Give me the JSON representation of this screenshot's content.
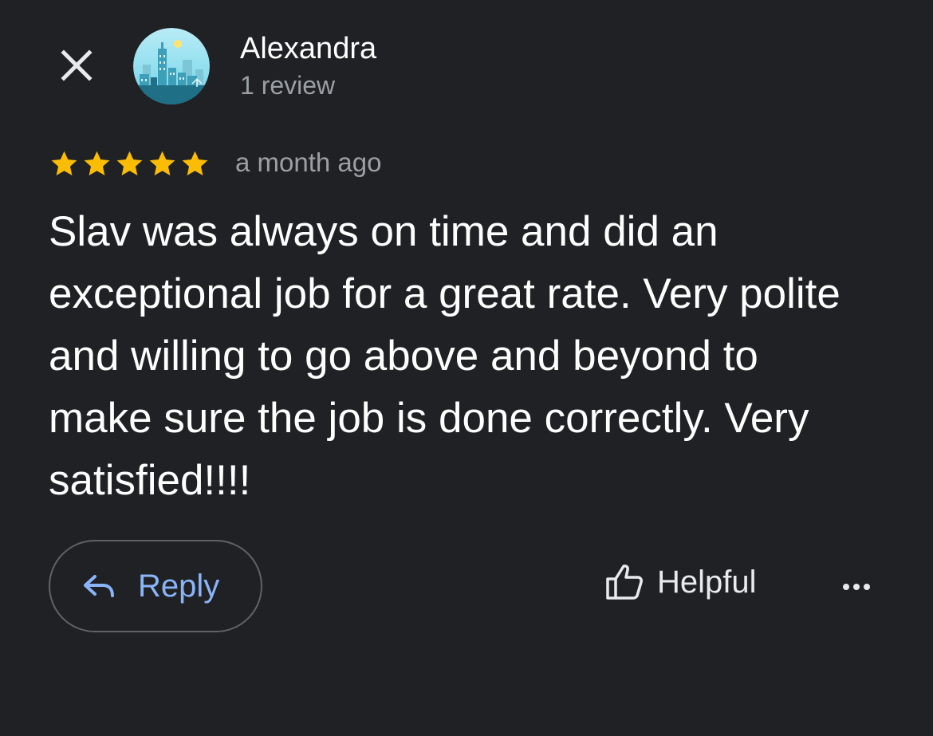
{
  "colors": {
    "background": "#202124",
    "primary_text": "#ffffff",
    "secondary_text": "#9aa0a6",
    "accent": "#8ab4f8",
    "star": "#fbbc04",
    "button_border": "#5f6368"
  },
  "header": {
    "close_icon": "close-icon",
    "avatar_icon": "city-skyline-avatar",
    "author_name": "Alexandra",
    "author_meta": "1 review"
  },
  "review": {
    "rating": 5,
    "rating_max": 5,
    "time_ago": "a month ago",
    "text": "Slav was always on time and did an exceptional job for a great rate. Very polite and willing to go above and beyond to make sure the job is done correctly. Very satisfied!!!!"
  },
  "actions": {
    "reply_icon": "reply-arrow-icon",
    "reply_label": "Reply",
    "helpful_icon": "thumbs-up-icon",
    "helpful_label": "Helpful",
    "more_icon": "more-horizontal-icon"
  }
}
